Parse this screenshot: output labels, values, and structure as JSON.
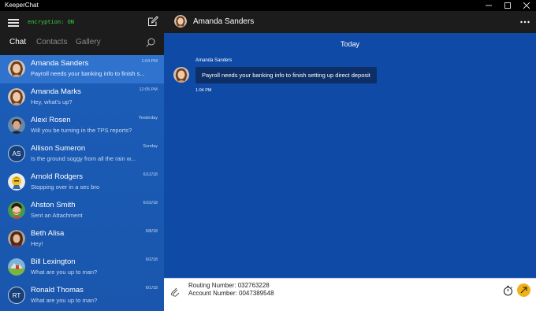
{
  "window": {
    "title": "KeeperChat"
  },
  "sidebar": {
    "encryption_status": "encryption: ON",
    "tabs": [
      {
        "label": "Chat",
        "active": true
      },
      {
        "label": "Contacts",
        "active": false
      },
      {
        "label": "Gallery",
        "active": false
      }
    ],
    "conversations": [
      {
        "name": "Amanda Sanders",
        "snippet": "Payroll needs your banking info to finish s...",
        "time": "1:04 PM",
        "avatar": "photo",
        "selected": true
      },
      {
        "name": "Amanda Marks",
        "snippet": "Hey, what's up?",
        "time": "12:05 PM",
        "avatar": "photo",
        "selected": false
      },
      {
        "name": "Alexi Rosen",
        "snippet": "Will you be turning in the TPS reports?",
        "time": "Yesterday",
        "avatar": "photo",
        "selected": false
      },
      {
        "name": "Allison Sumeron",
        "snippet": "Is the ground soggy from all the rain w...",
        "time": "Sunday",
        "avatar": "initials",
        "initials": "AS",
        "selected": false
      },
      {
        "name": "Arnold Rodgers",
        "snippet": "Stopping over in a sec bro",
        "time": "6/12/18",
        "avatar": "photo",
        "selected": false
      },
      {
        "name": "Ahston Smith",
        "snippet": "Sent an Attachment",
        "time": "6/10/18",
        "avatar": "photo",
        "selected": false
      },
      {
        "name": "Beth Alisa",
        "snippet": "Hey!",
        "time": "6/8/18",
        "avatar": "photo",
        "selected": false
      },
      {
        "name": "Bill Lexington",
        "snippet": "What are you up to man?",
        "time": "6/2/18",
        "avatar": "photo",
        "selected": false
      },
      {
        "name": "Ronald Thomas",
        "snippet": "What are you up to man?",
        "time": "6/1/18",
        "avatar": "initials",
        "initials": "RT",
        "selected": false
      }
    ]
  },
  "chat": {
    "contact_name": "Amanda Sanders",
    "day_label": "Today",
    "messages": [
      {
        "author": "Amanda Sanders",
        "text": "Payroll needs your banking info to finish setting up direct deposit",
        "time": "1:04 PM"
      }
    ]
  },
  "composer": {
    "line1": "Routing Number: 032763228",
    "line2": "Account Number: 0047389548"
  },
  "colors": {
    "accent": "#1657b1",
    "selected_row": "#2f73cf",
    "encryption_text": "#3dd13d",
    "send_button": "#f0b21a"
  },
  "icons": [
    "menu-icon",
    "compose-icon",
    "search-icon",
    "more-icon",
    "attach-icon",
    "timer-icon",
    "send-icon",
    "minimize-icon",
    "maximize-icon",
    "close-icon"
  ]
}
